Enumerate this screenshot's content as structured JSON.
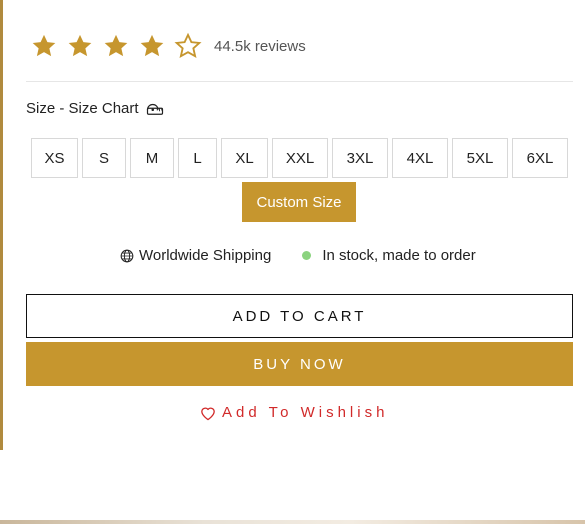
{
  "rating": {
    "filled_stars": 4,
    "total_stars": 5,
    "reviews_text": "44.5k reviews",
    "star_color": "#c6962e"
  },
  "size": {
    "label": "Size - Size Chart",
    "options": [
      "XS",
      "S",
      "M",
      "L",
      "XL",
      "XXL",
      "3XL",
      "4XL",
      "5XL",
      "6XL"
    ],
    "custom_label": "Custom Size"
  },
  "info": {
    "shipping": "Worldwide Shipping",
    "stock": "In stock, made to order",
    "stock_dot_color": "#8bd37f"
  },
  "actions": {
    "add_to_cart": "ADD TO CART",
    "buy_now": "BUY NOW",
    "wishlist": "Add To Wishlish"
  },
  "colors": {
    "accent": "#c6962e",
    "wishlist": "#d12a2a"
  }
}
